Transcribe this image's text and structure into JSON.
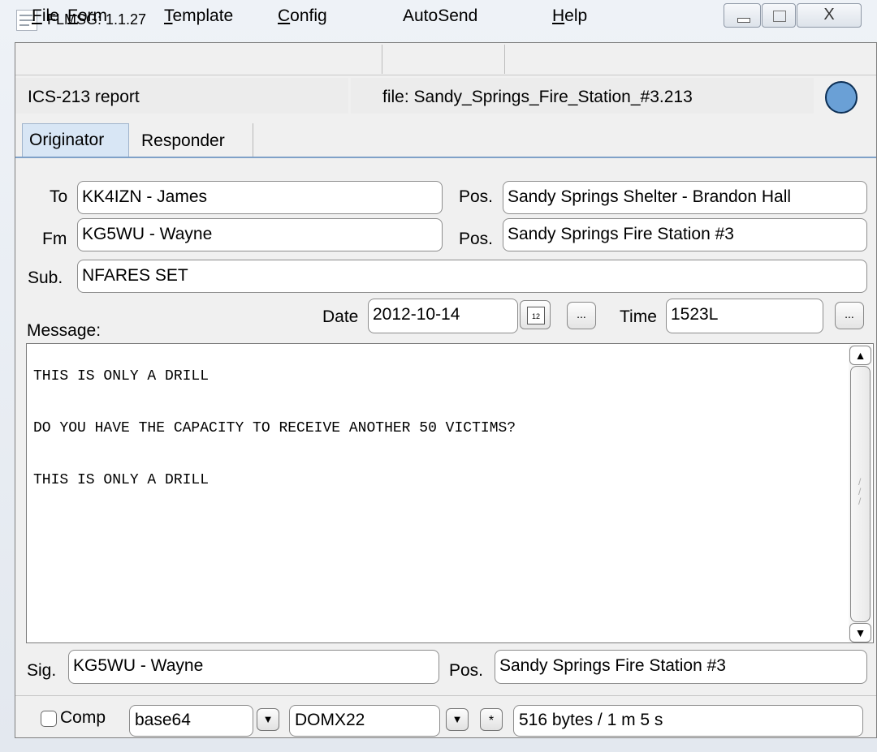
{
  "window": {
    "title": "FLMSG: 1.1.27",
    "close_glyph": "X"
  },
  "menu": {
    "file": {
      "pre": "",
      "accel": "F",
      "post": "ile"
    },
    "form": {
      "pre": "",
      "accel": "F",
      "post": "orm"
    },
    "template": {
      "pre": "",
      "accel": "T",
      "post": "emplate"
    },
    "config": {
      "pre": "",
      "accel": "C",
      "post": "onfig"
    },
    "autosend": "AutoSend",
    "help": {
      "pre": "",
      "accel": "H",
      "post": "elp"
    }
  },
  "header": {
    "report_type": "ICS-213 report",
    "file_label": "file: Sandy_Springs_Fire_Station_#3.213",
    "status_color": "#6aa0d6"
  },
  "tabs": [
    {
      "label": "Originator",
      "active": true
    },
    {
      "label": "Responder",
      "active": false
    }
  ],
  "form": {
    "to_label": "To",
    "to_value": "KK4IZN - James",
    "to_pos_label": "Pos.",
    "to_pos_value": "Sandy Springs Shelter - Brandon Hall",
    "fm_label": "Fm",
    "fm_value": "KG5WU - Wayne",
    "fm_pos_label": "Pos.",
    "fm_pos_value": "Sandy Springs Fire Station #3",
    "sub_label": "Sub.",
    "sub_value": "NFARES SET",
    "date_label": "Date",
    "date_value": "2012-10-14",
    "calendar_glyph": "12",
    "ellipsis": "...",
    "time_label": "Time",
    "time_value": "1523L",
    "message_label": "Message:",
    "message_text": "THIS IS ONLY A DRILL\n\nDO YOU HAVE THE CAPACITY TO RECEIVE ANOTHER 50 VICTIMS?\n\nTHIS IS ONLY A DRILL",
    "sig_label": "Sig.",
    "sig_value": "KG5WU - Wayne",
    "sig_pos_label": "Pos.",
    "sig_pos_value": "Sandy Springs Fire Station #3"
  },
  "bottom": {
    "comp_label": "Comp",
    "comp_checked": false,
    "encoding": "base64",
    "mode": "DOMX22",
    "star": "*",
    "size_info": "516 bytes / 1 m 5 s"
  }
}
